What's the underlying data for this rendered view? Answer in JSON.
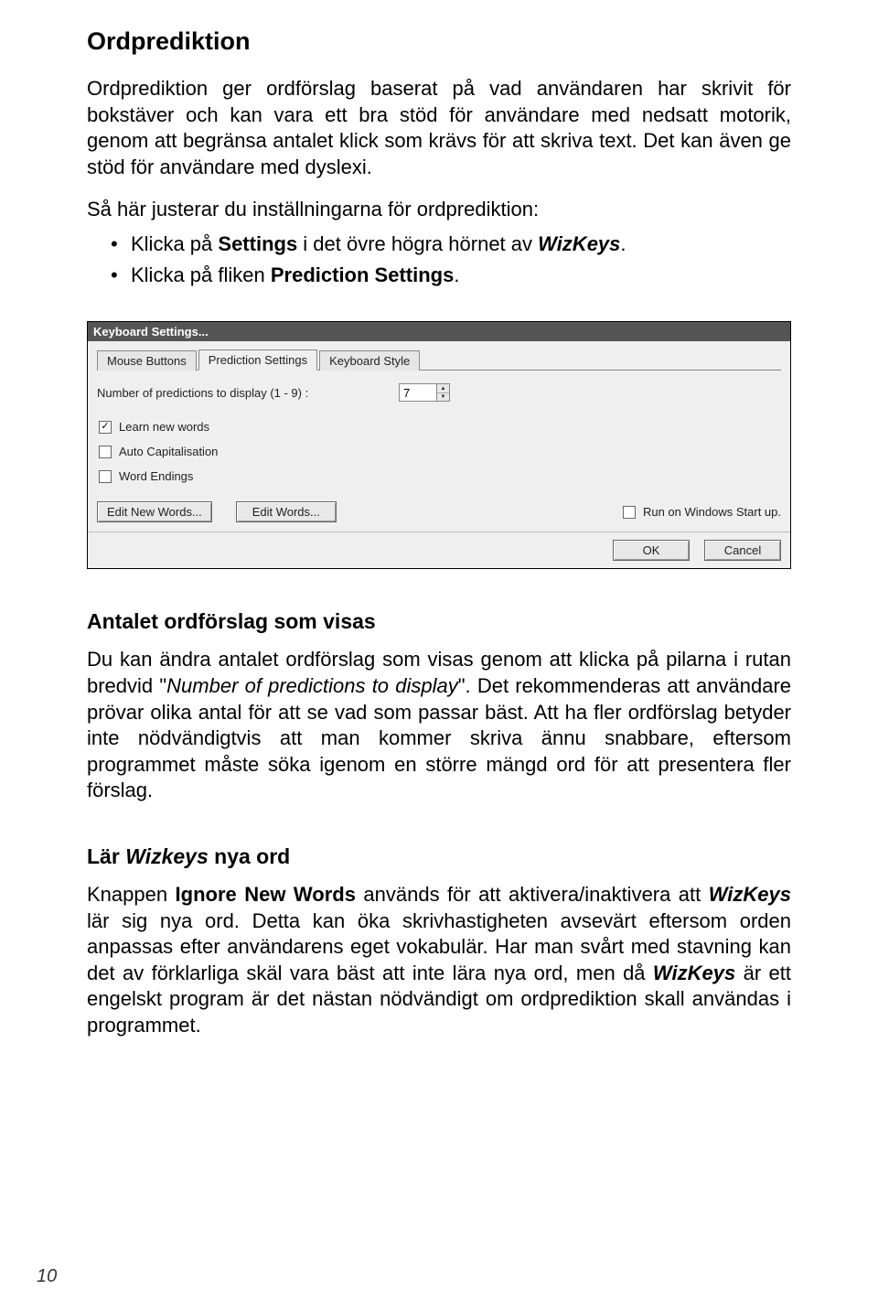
{
  "heading_main": "Ordprediktion",
  "para1": "Ordprediktion ger ordförslag baserat på vad användaren har skrivit för bokstäver och kan vara ett bra stöd för användare med nedsatt motorik, genom att begränsa antalet klick som krävs för att skriva text. Det kan även ge stöd för användare med dyslexi.",
  "lead1": "Så här justerar du inställningarna för ordprediktion:",
  "bullet1_pre": "Klicka på ",
  "bullet1_bold": "Settings",
  "bullet1_mid": " i det övre högra hörnet av ",
  "bullet1_emi": "WizKeys",
  "bullet1_post": ".",
  "bullet2_pre": "Klicka på fliken ",
  "bullet2_bold": "Prediction Settings",
  "bullet2_post": ".",
  "dialog": {
    "title": "Keyboard Settings...",
    "tab_mouse": "Mouse Buttons",
    "tab_pred": "Prediction Settings",
    "tab_style": "Keyboard Style",
    "num_label": "Number of predictions to display (1 - 9) :",
    "num_value": "7",
    "learn_label": "Learn new words",
    "auto_label": "Auto Capitalisation",
    "endings_label": "Word Endings",
    "edit_new": "Edit New Words...",
    "edit_words": "Edit Words...",
    "run_label": "Run on Windows Start up.",
    "ok": "OK",
    "cancel": "Cancel"
  },
  "h2a": "Antalet ordförslag som visas",
  "para2_pre": "Du kan ändra antalet ordförslag som visas genom att klicka på pilarna i rutan bredvid \"",
  "para2_emi": "Number of predictions to display",
  "para2_post": "\". Det rekommenderas att användare prövar olika antal för att se vad som passar bäst. Att ha fler ordförslag betyder inte nödvändigtvis att man kommer skriva ännu snabbare, eftersom programmet måste söka igenom en större mängd ord för att presentera fler förslag.",
  "h2b_pre": "Lär ",
  "h2b_emi": "Wizkeys",
  "h2b_post": " nya ord",
  "para3_pre": "Knappen ",
  "para3_bold": "Ignore New Words",
  "para3_mid1": " används för att aktivera/inaktivera att ",
  "para3_emi1": "WizKeys",
  "para3_mid2": " lär sig nya ord. Detta kan öka skrivhastigheten avsevärt eftersom orden anpassas efter användarens eget vokabulär. Har man svårt med stavning kan det av förklarliga skäl vara bäst att inte lära nya ord, men då ",
  "para3_emi2": "WizKeys",
  "para3_post": " är ett engelskt program är det nästan nödvändigt om ordprediktion skall användas i programmet.",
  "page_number": "10"
}
